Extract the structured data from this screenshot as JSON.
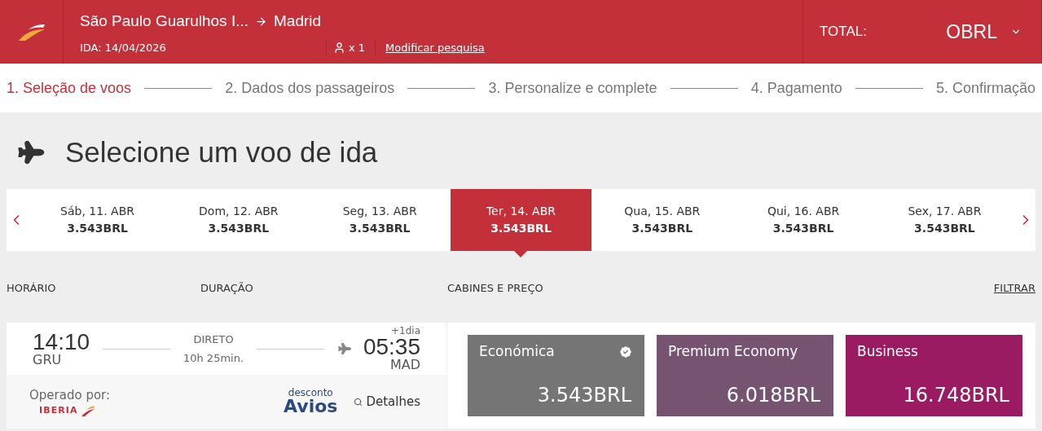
{
  "header": {
    "route_from": "São Paulo Guarulhos I...",
    "route_to": "Madrid",
    "date": "IDA: 14/04/2026",
    "passengers": "x 1",
    "modify_link": "Modificar pesquisa",
    "total_label": "TOTAL:",
    "total_value": "OBRL"
  },
  "steps": [
    {
      "label": "1. Seleção de voos",
      "selected": true
    },
    {
      "label": "2. Dados dos passageiros",
      "selected": false
    },
    {
      "label": "3. Personalize e complete",
      "selected": false
    },
    {
      "label": "4. Pagamento",
      "selected": false
    },
    {
      "label": "5. Confirmação",
      "selected": false
    }
  ],
  "title": "Selecione um voo de ida",
  "dates": [
    {
      "day": "Sáb, 11. ABR",
      "price": "3.543BRL",
      "selected": false
    },
    {
      "day": "Dom, 12. ABR",
      "price": "3.543BRL",
      "selected": false
    },
    {
      "day": "Seg, 13. ABR",
      "price": "3.543BRL",
      "selected": false
    },
    {
      "day": "Ter, 14. ABR",
      "price": "3.543BRL",
      "selected": true
    },
    {
      "day": "Qua, 15. ABR",
      "price": "3.543BRL",
      "selected": false
    },
    {
      "day": "Qui, 16. ABR",
      "price": "3.543BRL",
      "selected": false
    },
    {
      "day": "Sex, 17. ABR",
      "price": "3.543BRL",
      "selected": false
    }
  ],
  "columns": {
    "schedule": "HORÁRIO",
    "duration": "DURAÇÃO",
    "cabins": "CABINES E PREÇO",
    "filter": "FILTRAR"
  },
  "flight": {
    "depart_time": "14:10",
    "depart_code": "GRU",
    "type": "DIRETO",
    "duration": "10h 25min.",
    "next_day": "+1dia",
    "arrive_time": "05:35",
    "arrive_code": "MAD",
    "operated_by": "Operado por:",
    "operator": "IBERIA",
    "discount_top": "desconto",
    "discount_brand": "Avios",
    "details": "Detalhes"
  },
  "cabins": [
    {
      "name": "Económica",
      "price": "3.543BRL",
      "color": "#757575",
      "selected": true
    },
    {
      "name": "Premium Economy",
      "price": "6.018BRL",
      "color": "#765370",
      "selected": false
    },
    {
      "name": "Business",
      "price": "16.748BRL",
      "color": "#9a1b62",
      "selected": false
    }
  ]
}
